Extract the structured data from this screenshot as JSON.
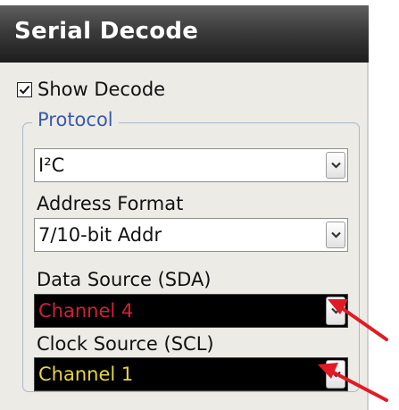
{
  "panel": {
    "title": "Serial Decode",
    "show_decode": {
      "label": "Show Decode",
      "checked": true
    },
    "protocol_group": {
      "legend": "Protocol",
      "protocol_dropdown": {
        "value": "I²C"
      },
      "address_format": {
        "label": "Address Format",
        "value": "7/10-bit Addr"
      },
      "data_source": {
        "label": "Data Source (SDA)",
        "value": "Channel 4",
        "color": "#d0203a"
      },
      "clock_source": {
        "label": "Clock Source (SCL)",
        "value": "Channel 1",
        "color": "#e6d63a"
      }
    }
  },
  "colors": {
    "accent_legend": "#3a5aa8",
    "annotation_arrow": "#e01b24",
    "dark_field_bg": "#000000"
  },
  "icons": {
    "dropdown": "chevron-down-icon",
    "checkbox": "check-icon"
  }
}
